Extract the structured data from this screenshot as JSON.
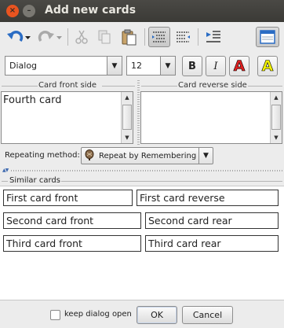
{
  "window": {
    "title": "Add new cards",
    "close_glyph": "×",
    "minimize_glyph": "–"
  },
  "toolbar": {
    "icons": [
      "undo-icon",
      "redo-icon",
      "cut-icon",
      "copy-icon",
      "paste-icon",
      "text-align-icon",
      "text-align-alt-icon",
      "insert-indent-icon",
      "window-layout-icon"
    ]
  },
  "format": {
    "font_family": "Dialog",
    "font_size": "12",
    "bold_label": "B",
    "italic_label": "I",
    "text_color_label": "A",
    "highlight_label": "A",
    "text_color": "#e02020",
    "highlight_color": "#f2f200"
  },
  "front": {
    "label": "Card front side",
    "text": "Fourth card"
  },
  "reverse": {
    "label": "Card reverse side",
    "text": ""
  },
  "repeating": {
    "label": "Repeating method:",
    "value": "Repeat by Remembering",
    "icon": "brain-icon"
  },
  "similar": {
    "title": "Similar cards",
    "cards": [
      {
        "front": "First card front",
        "reverse": "First card reverse"
      },
      {
        "front": "Second card front",
        "reverse": "Second card rear"
      },
      {
        "front": "Third card front",
        "reverse": "Third card rear"
      }
    ]
  },
  "footer": {
    "keep_open_label": "keep dialog open",
    "keep_open_checked": false,
    "ok_label": "OK",
    "cancel_label": "Cancel"
  }
}
